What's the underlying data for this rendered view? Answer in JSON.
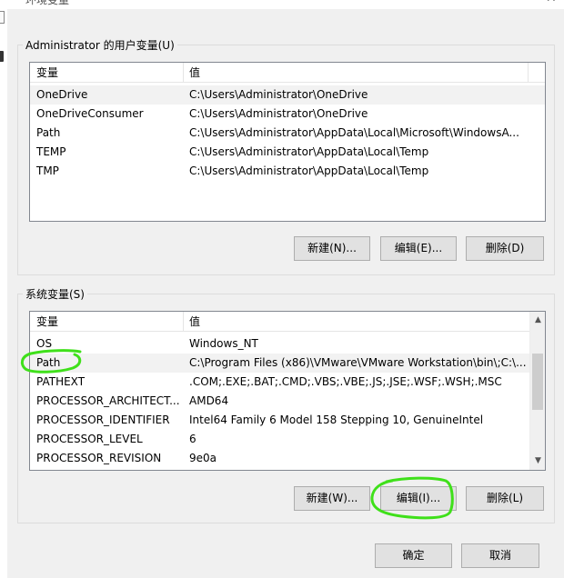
{
  "window": {
    "title": "环境变量",
    "close_glyph": "✕"
  },
  "user_vars": {
    "group_label": "Administrator 的用户变量(U)",
    "columns": {
      "name": "变量",
      "value": "值"
    },
    "rows": [
      {
        "name": "OneDrive",
        "value": "C:\\Users\\Administrator\\OneDrive"
      },
      {
        "name": "OneDriveConsumer",
        "value": "C:\\Users\\Administrator\\OneDrive"
      },
      {
        "name": "Path",
        "value": "C:\\Users\\Administrator\\AppData\\Local\\Microsoft\\WindowsA..."
      },
      {
        "name": "TEMP",
        "value": "C:\\Users\\Administrator\\AppData\\Local\\Temp"
      },
      {
        "name": "TMP",
        "value": "C:\\Users\\Administrator\\AppData\\Local\\Temp"
      }
    ],
    "buttons": {
      "new": "新建(N)...",
      "edit": "编辑(E)...",
      "delete": "删除(D)"
    }
  },
  "system_vars": {
    "group_label": "系统变量(S)",
    "columns": {
      "name": "变量",
      "value": "值"
    },
    "rows": [
      {
        "name": "OS",
        "value": "Windows_NT"
      },
      {
        "name": "Path",
        "value": "C:\\Program Files (x86)\\VMware\\VMware Workstation\\bin\\;C:\\..."
      },
      {
        "name": "PATHEXT",
        "value": ".COM;.EXE;.BAT;.CMD;.VBS;.VBE;.JS;.JSE;.WSF;.WSH;.MSC"
      },
      {
        "name": "PROCESSOR_ARCHITECT...",
        "value": "AMD64"
      },
      {
        "name": "PROCESSOR_IDENTIFIER",
        "value": "Intel64 Family 6 Model 158 Stepping 10, GenuineIntel"
      },
      {
        "name": "PROCESSOR_LEVEL",
        "value": "6"
      },
      {
        "name": "PROCESSOR_REVISION",
        "value": "9e0a"
      }
    ],
    "buttons": {
      "new": "新建(W)...",
      "edit": "编辑(I)...",
      "delete": "删除(L)"
    }
  },
  "footer": {
    "ok": "确定",
    "cancel": "取消"
  },
  "colors": {
    "annotation": "#3fe01a",
    "selected_row": "#f2f2f2",
    "dialog_bg": "#f0f0f0"
  },
  "icons": {
    "scroll_up": "▲",
    "scroll_down": "▼"
  }
}
